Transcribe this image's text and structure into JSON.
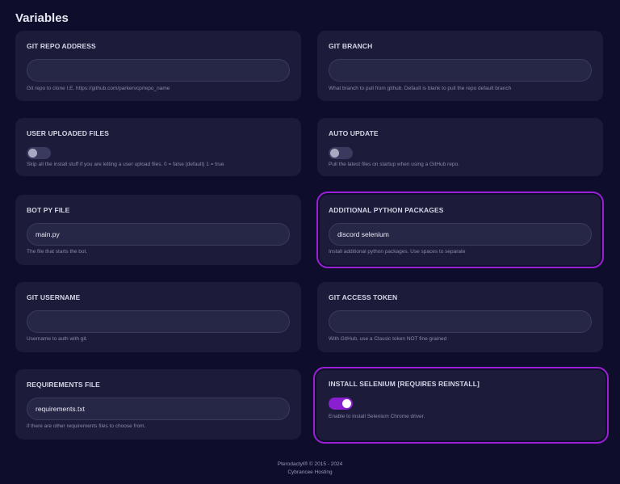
{
  "page": {
    "title": "Variables"
  },
  "cards": {
    "git_repo": {
      "label": "GIT REPO ADDRESS",
      "value": "",
      "help": "Git repo to clone I.E. https://github.com/parkervcp/repo_name"
    },
    "git_branch": {
      "label": "GIT BRANCH",
      "value": "",
      "help": "What branch to pull from github. Default is blank to pull the repo default branch"
    },
    "user_uploaded": {
      "label": "USER UPLOADED FILES",
      "enabled": false,
      "help": "Skip all the install stuff if you are letting a user upload files. 0 = false (default) 1 = true"
    },
    "auto_update": {
      "label": "AUTO UPDATE",
      "enabled": false,
      "help": "Pull the latest files on startup when using a GitHub repo."
    },
    "bot_py": {
      "label": "BOT PY FILE",
      "value": "main.py",
      "help": "The file that starts the bot."
    },
    "py_packages": {
      "label": "ADDITIONAL PYTHON PACKAGES",
      "value": "discord selenium",
      "help": "Install additional python packages. Use spaces to separate"
    },
    "git_username": {
      "label": "GIT USERNAME",
      "value": "",
      "help": "Username to auth with git."
    },
    "git_token": {
      "label": "GIT ACCESS TOKEN",
      "value": "",
      "help": "With GitHub, use a Classic token NOT fine grained"
    },
    "requirements": {
      "label": "REQUIREMENTS FILE",
      "value": "requirements.txt",
      "help": "if there are other requirements files to choose from."
    },
    "selenium": {
      "label": "INSTALL SELENIUM [REQUIRES REINSTALL]",
      "enabled": true,
      "help": "Enable to install Selenium Chrome driver."
    }
  },
  "footer": {
    "line1": "Pterodactyl® © 2015 - 2024",
    "line2": "Cybrancee Hosting"
  },
  "colors": {
    "background": "#0e0e2c",
    "card": "#1c1c3a",
    "highlight": "#9b1fd4",
    "toggle_on": "#8a1fd0"
  }
}
